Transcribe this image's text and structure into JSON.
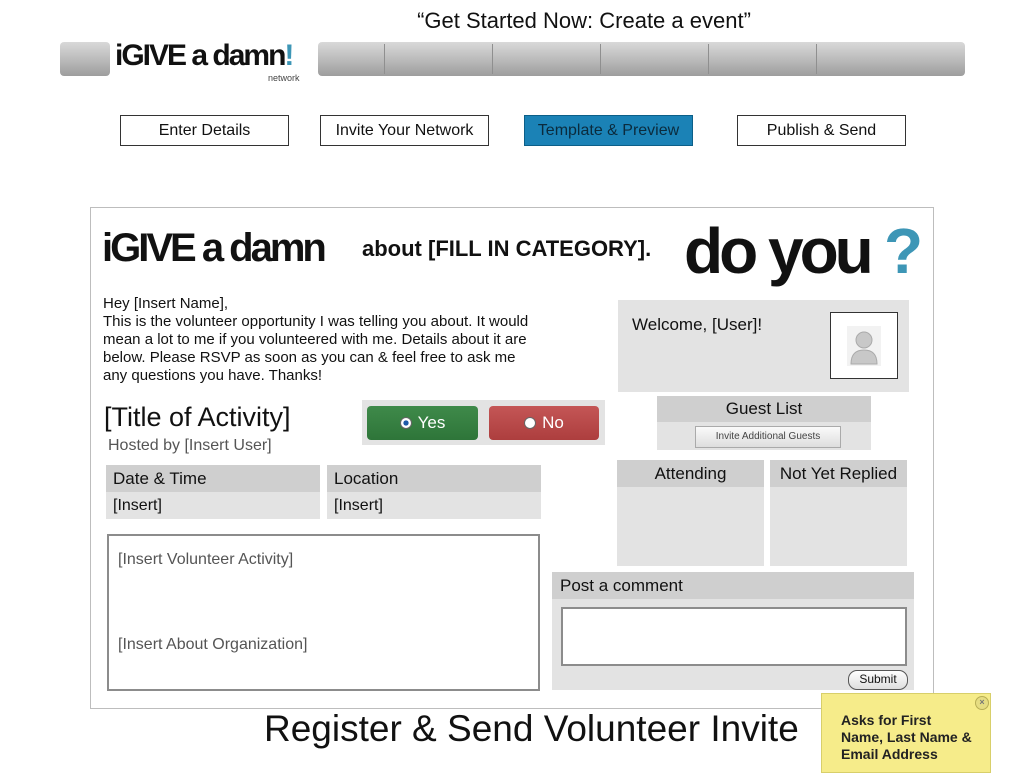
{
  "page_title": "“Get Started Now: Create a event”",
  "logo": {
    "main": "iGIVE a damn",
    "bang": "!",
    "sub": "network"
  },
  "steps": [
    {
      "label": "Enter Details",
      "active": false
    },
    {
      "label": "Invite Your Network",
      "active": false
    },
    {
      "label": "Template & Preview",
      "active": true
    },
    {
      "label": "Publish & Send",
      "active": false
    }
  ],
  "preview": {
    "header": {
      "igive": "iGIVE a damn",
      "about": "about [FILL IN CATEGORY].",
      "do_you": "do you",
      "question_mark": "?"
    },
    "message_lines": [
      "Hey [Insert Name],",
      "This is the volunteer opportunity I was telling you about. It would",
      "mean a lot to me if you volunteered with me. Details about it are",
      "below. Please RSVP as soon as you can & feel free to ask me",
      "any questions you have. Thanks!"
    ],
    "activity_title": "[Title of Activity]",
    "hosted_by": "Hosted by [Insert User]",
    "rsvp": {
      "yes": "Yes",
      "no": "No",
      "selected": "yes"
    },
    "date_time": {
      "label": "Date & Time",
      "value": "[Insert]"
    },
    "location": {
      "label": "Location",
      "value": "[Insert]"
    },
    "description": {
      "activity": "[Insert Volunteer Activity]",
      "organization": "[Insert About Organization]"
    },
    "welcome": "Welcome, [User]!",
    "guest_list": {
      "title": "Guest List",
      "invite_button": "Invite Additional Guests"
    },
    "attending": "Attending",
    "not_yet_replied": "Not Yet Replied",
    "comment": {
      "title": "Post a comment",
      "input_value": "",
      "submit": "Submit"
    }
  },
  "footer": "Register & Send Volunteer Invite",
  "sticky_note": {
    "lines": [
      "Asks for First",
      "Name, Last Name &",
      "Email Address"
    ],
    "close": "×",
    "color": "#f6ec8a"
  },
  "colors": {
    "accent": "#3d96b6",
    "active_step": "#1b82b6",
    "yes": "#2e7539",
    "no": "#ad3e3e"
  },
  "icons": [
    "radio-checked-icon",
    "radio-unchecked-icon",
    "user-silhouette-icon",
    "close-icon"
  ]
}
